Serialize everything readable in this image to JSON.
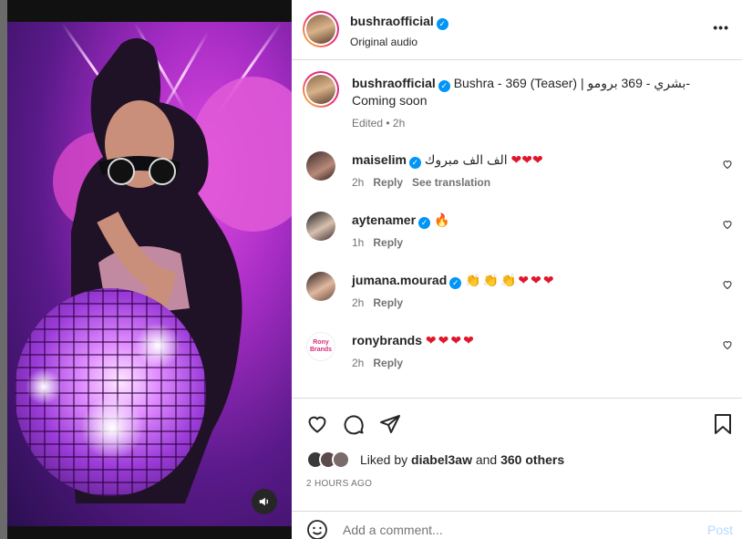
{
  "post": {
    "author": "bushraofficial",
    "audio": "Original audio",
    "more_label": "•••"
  },
  "caption": {
    "author": "bushraofficial",
    "text": "Bushra - 369 (Teaser) | بشري - 369 برومو-",
    "text_line2": "Coming soon",
    "meta": "Edited • 2h"
  },
  "comments": [
    {
      "user": "maiselim",
      "text": "الف الف مبروك",
      "emoji": "❤❤❤",
      "time": "2h",
      "reply": "Reply",
      "translate": "See translation"
    },
    {
      "user": "aytenamer",
      "text": "",
      "emoji": "🔥",
      "time": "1h",
      "reply": "Reply"
    },
    {
      "user": "jumana.mourad",
      "text": "",
      "emoji": "👏👏👏❤❤❤",
      "time": "2h",
      "reply": "Reply"
    },
    {
      "user": "ronybrands",
      "text": "",
      "emoji": "❤❤❤❤",
      "time": "2h",
      "reply": "Reply",
      "avatar_text": "Rony Brands"
    }
  ],
  "likes": {
    "prefix": "Liked by",
    "user": "diabel3aw",
    "and": "and",
    "others": "360 others"
  },
  "timestamp": "2 HOURS AGO",
  "composer": {
    "placeholder": "Add a comment...",
    "post_label": "Post"
  },
  "colors": {
    "verified": "#0095f6",
    "heart": "#e0162b",
    "post_disabled": "#b3dbff"
  }
}
